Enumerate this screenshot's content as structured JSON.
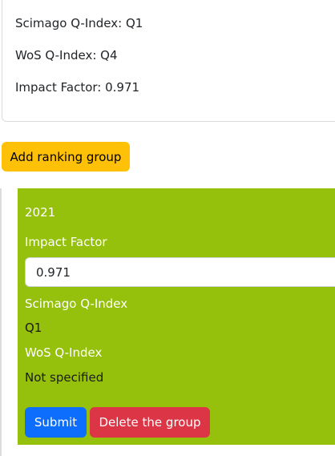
{
  "summary": {
    "scimago_line": "Scimago Q-Index: Q1",
    "wos_line": "WoS Q-Index: Q4",
    "impact_line": "Impact Factor: 0.971"
  },
  "add_group_button": "Add ranking group",
  "group": {
    "year": "2021",
    "impact_factor_label": "Impact Factor",
    "impact_factor_value": "0.971",
    "scimago_label": "Scimago Q-Index",
    "scimago_value": "Q1",
    "wos_label": "WoS Q-Index",
    "wos_value": "Not specified",
    "submit_label": "Submit",
    "delete_label": "Delete the group",
    "panel_color": "#95c00b"
  }
}
